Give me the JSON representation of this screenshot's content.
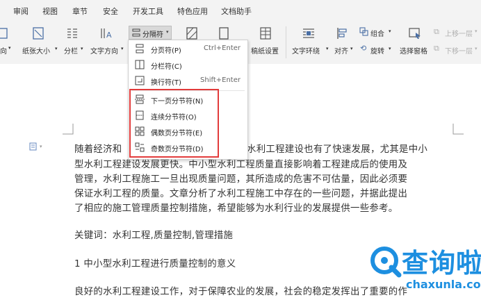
{
  "menu": [
    "审阅",
    "视图",
    "章节",
    "安全",
    "开发工具",
    "特色应用",
    "文档助手"
  ],
  "ribbon": {
    "direction_partial": "向",
    "paper_size": "纸张大小",
    "columns": "分栏",
    "text_direction": "文字方向",
    "separator": "分隔符",
    "manuscript_setting": "稿纸设置",
    "text_wrap": "文字环绕",
    "align": "对齐",
    "group": "组合",
    "rotate": "旋转",
    "selection_pane": "选择窗格",
    "bring_forward": "上移一层",
    "send_backward": "下移一层"
  },
  "dropdown": {
    "items": [
      {
        "label": "分页符(P)",
        "shortcut": "Ctrl+Enter",
        "icon": "page-break-icon"
      },
      {
        "label": "分栏符(C)",
        "shortcut": "",
        "icon": "column-break-icon"
      },
      {
        "label": "换行符(T)",
        "shortcut": "Shift+Enter",
        "icon": "line-break-icon"
      },
      {
        "label": "下一页分节符(N)",
        "shortcut": "",
        "icon": "next-page-section-icon"
      },
      {
        "label": "连续分节符(O)",
        "shortcut": "",
        "icon": "continuous-section-icon"
      },
      {
        "label": "偶数页分节符(E)",
        "shortcut": "",
        "icon": "even-page-section-icon"
      },
      {
        "label": "奇数页分节符(D)",
        "shortcut": "",
        "icon": "odd-page-section-icon"
      }
    ]
  },
  "document": {
    "line1_a": "随着经济和",
    "line1_b": "水利工程建设也有了快速发展，尤其是中小",
    "line2": "型水利工程建设发展更快。中小型水利工程质量直接影响着工程建成后的使用及",
    "line3": "管理，水利工程施工一旦出现质量问题，其所造成的危害不可估量，因此必须要",
    "line4": "保证水利工程的质量。文章分析了水利工程施工中存在的一些问题，并据此提出",
    "line5": "了相应的施工管理质量控制措施，希望能够为水利行业的发展提供一些参考。",
    "keywords": "关键词：水利工程,质量控制,管理措施",
    "heading": "1 中小型水利工程进行质量控制的意义",
    "line6": "良好的水利工程建设工作，对于保障农业的发展，社会的稳定发挥出了重要的作"
  },
  "watermark": {
    "brand": "查询啦",
    "url": "chaxunla.com"
  },
  "colors": {
    "accent": "#e23b3b",
    "watermark": "#1d8fe0",
    "toolbar": "#f3f3f3"
  }
}
